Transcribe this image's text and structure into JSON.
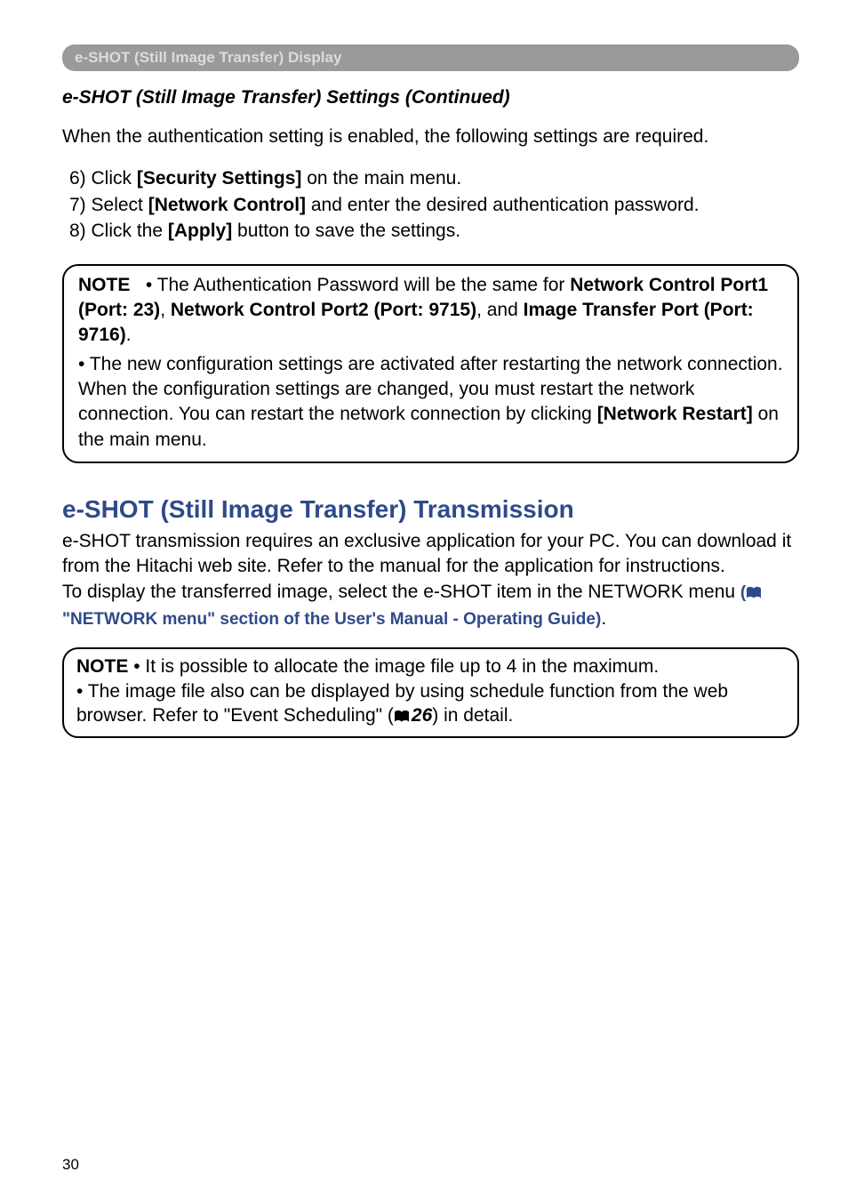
{
  "section_tab": "e-SHOT (Still Image Transfer) Display",
  "subtitle": "e-SHOT (Still Image Transfer) Settings (Continued)",
  "intro": "When the authentication setting is enabled, the following settings are required.",
  "steps": {
    "s6_pre": " 6) Click ",
    "s6_bold": "[Security Settings]",
    "s6_post": " on the main menu.",
    "s7_pre": " 7) Select ",
    "s7_bold": "[Network Control]",
    "s7_post": " and enter the desired authentication password.",
    "s8_pre": " 8) Click the ",
    "s8_bold": "[Apply]",
    "s8_post": " button to save the settings."
  },
  "note1": {
    "label": "NOTE",
    "p1a": "• The Authentication Password will be the same for ",
    "p1b": "Network Control Port1 (Port: 23)",
    "p1c": ", ",
    "p1d": "Network Control Port2 (Port: 9715)",
    "p1e": ", and ",
    "p1f": "Image Transfer Port (Port: 9716)",
    "p1g": ".",
    "p2a": "• The new configuration settings are activated after restarting the network connection. When the configuration settings are changed, you must restart the network connection. You can restart the network connection by clicking ",
    "p2b": "[Network Restart]",
    "p2c": " on the main menu."
  },
  "h2": "e-SHOT (Still Image Transfer) Transmission",
  "body2": {
    "p1": "e-SHOT transmission requires an exclusive application for your PC. You can download it from the Hitachi web site. Refer to the manual for the application for instructions.",
    "p2a": "To display the transferred image, select the e-SHOT item in the NETWORK menu ",
    "p2_paren_open": "(",
    "p2b": "\"NETWORK menu\" section of the User's Manual - Operating Guide)",
    "p2c": "."
  },
  "note2": {
    "label": "NOTE",
    "p1": "• It is possible to allocate the image file up to 4 in the maximum.",
    "p2a": "• The image file also can be displayed by using schedule function from the web browser. Refer to \"Event Scheduling\" (",
    "p2ref": "26",
    "p2b": ") in detail."
  },
  "page_number": "30"
}
